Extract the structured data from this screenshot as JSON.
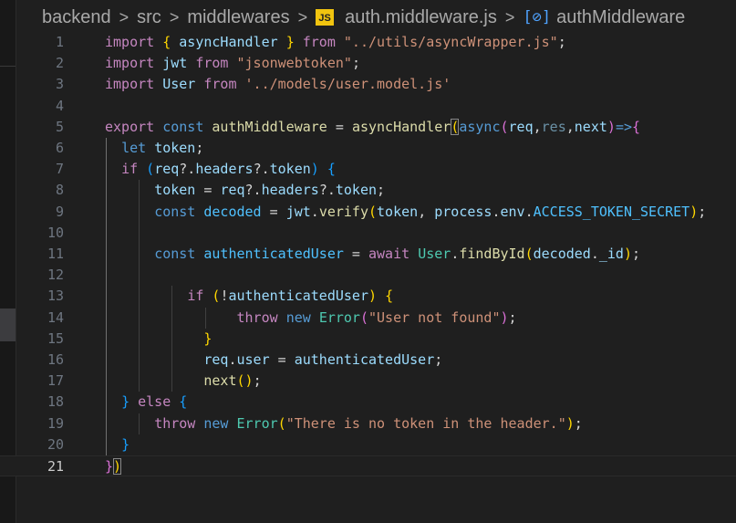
{
  "breadcrumb": {
    "items": [
      "backend",
      "src",
      "middlewares"
    ],
    "file_icon": "JS",
    "file": "auth.middleware.js",
    "symbol": "authMiddleware",
    "separator": ">"
  },
  "editor": {
    "active_line": 21,
    "lines": [
      [
        [
          "import",
          "kw"
        ],
        [
          " ",
          "p"
        ],
        [
          "{",
          "b1"
        ],
        [
          " asyncHandler ",
          "var"
        ],
        [
          "}",
          "b1"
        ],
        [
          " ",
          "p"
        ],
        [
          "from",
          "kw"
        ],
        [
          " ",
          "p"
        ],
        [
          "\"../utils/asyncWrapper.js\"",
          "str"
        ],
        [
          ";",
          "p"
        ]
      ],
      [
        [
          "import",
          "kw"
        ],
        [
          " ",
          "p"
        ],
        [
          "jwt",
          "var"
        ],
        [
          " ",
          "p"
        ],
        [
          "from",
          "kw"
        ],
        [
          " ",
          "p"
        ],
        [
          "\"jsonwebtoken\"",
          "str"
        ],
        [
          ";",
          "p"
        ]
      ],
      [
        [
          "import",
          "kw"
        ],
        [
          " ",
          "p"
        ],
        [
          "User",
          "var"
        ],
        [
          " ",
          "p"
        ],
        [
          "from",
          "kw"
        ],
        [
          " ",
          "p"
        ],
        [
          "'../models/user.model.js'",
          "str"
        ]
      ],
      [],
      [
        [
          "export",
          "kw"
        ],
        [
          " ",
          "p"
        ],
        [
          "const",
          "st"
        ],
        [
          " ",
          "p"
        ],
        [
          "authMiddleware",
          "fn"
        ],
        [
          " = ",
          "p"
        ],
        [
          "asyncHandler",
          "fn"
        ],
        [
          "(",
          "b1 match"
        ],
        [
          "async",
          "st"
        ],
        [
          "(",
          "b2"
        ],
        [
          "req",
          "var"
        ],
        [
          ",",
          "p"
        ],
        [
          "res",
          "dim"
        ],
        [
          ",",
          "p"
        ],
        [
          "next",
          "var"
        ],
        [
          ")",
          "b2"
        ],
        [
          "=>",
          "st"
        ],
        [
          "{",
          "b2"
        ]
      ],
      [
        [
          "  ",
          "p"
        ],
        [
          "let",
          "st"
        ],
        [
          " ",
          "p"
        ],
        [
          "token",
          "var"
        ],
        [
          ";",
          "p"
        ]
      ],
      [
        [
          "  ",
          "p"
        ],
        [
          "if",
          "kw"
        ],
        [
          " ",
          "p"
        ],
        [
          "(",
          "b3"
        ],
        [
          "req",
          "var"
        ],
        [
          "?.",
          "p"
        ],
        [
          "headers",
          "var"
        ],
        [
          "?.",
          "p"
        ],
        [
          "token",
          "var"
        ],
        [
          ")",
          "b3"
        ],
        [
          " ",
          "p"
        ],
        [
          "{",
          "b3"
        ]
      ],
      [
        [
          "      ",
          "p"
        ],
        [
          "token",
          "var"
        ],
        [
          " = ",
          "p"
        ],
        [
          "req",
          "var"
        ],
        [
          "?.",
          "p"
        ],
        [
          "headers",
          "var"
        ],
        [
          "?.",
          "p"
        ],
        [
          "token",
          "var"
        ],
        [
          ";",
          "p"
        ]
      ],
      [
        [
          "      ",
          "p"
        ],
        [
          "const",
          "st"
        ],
        [
          " ",
          "p"
        ],
        [
          "decoded",
          "cst"
        ],
        [
          " = ",
          "p"
        ],
        [
          "jwt",
          "var"
        ],
        [
          ".",
          "p"
        ],
        [
          "verify",
          "fn"
        ],
        [
          "(",
          "b1"
        ],
        [
          "token",
          "var"
        ],
        [
          ", ",
          "p"
        ],
        [
          "process",
          "var"
        ],
        [
          ".",
          "p"
        ],
        [
          "env",
          "var"
        ],
        [
          ".",
          "p"
        ],
        [
          "ACCESS_TOKEN_SECRET",
          "cst"
        ],
        [
          ")",
          "b1"
        ],
        [
          ";",
          "p"
        ]
      ],
      [],
      [
        [
          "      ",
          "p"
        ],
        [
          "const",
          "st"
        ],
        [
          " ",
          "p"
        ],
        [
          "authenticatedUser",
          "cst"
        ],
        [
          " = ",
          "p"
        ],
        [
          "await",
          "kw"
        ],
        [
          " ",
          "p"
        ],
        [
          "User",
          "cls"
        ],
        [
          ".",
          "p"
        ],
        [
          "findById",
          "fn"
        ],
        [
          "(",
          "b1"
        ],
        [
          "decoded",
          "var"
        ],
        [
          ".",
          "p"
        ],
        [
          "_id",
          "var"
        ],
        [
          ")",
          "b1"
        ],
        [
          ";",
          "p"
        ]
      ],
      [],
      [
        [
          "          ",
          "p"
        ],
        [
          "if",
          "kw"
        ],
        [
          " ",
          "p"
        ],
        [
          "(",
          "b1"
        ],
        [
          "!",
          "p"
        ],
        [
          "authenticatedUser",
          "var"
        ],
        [
          ")",
          "b1"
        ],
        [
          " ",
          "p"
        ],
        [
          "{",
          "b1"
        ]
      ],
      [
        [
          "                ",
          "p"
        ],
        [
          "throw",
          "kw"
        ],
        [
          " ",
          "p"
        ],
        [
          "new",
          "st"
        ],
        [
          " ",
          "p"
        ],
        [
          "Error",
          "cls"
        ],
        [
          "(",
          "b2"
        ],
        [
          "\"User not found\"",
          "str"
        ],
        [
          ")",
          "b2"
        ],
        [
          ";",
          "p"
        ]
      ],
      [
        [
          "            ",
          "p"
        ],
        [
          "}",
          "b1"
        ]
      ],
      [
        [
          "            ",
          "p"
        ],
        [
          "req",
          "var"
        ],
        [
          ".",
          "p"
        ],
        [
          "user",
          "var"
        ],
        [
          " = ",
          "p"
        ],
        [
          "authenticatedUser",
          "var"
        ],
        [
          ";",
          "p"
        ]
      ],
      [
        [
          "            ",
          "p"
        ],
        [
          "next",
          "fn"
        ],
        [
          "(",
          "b1"
        ],
        [
          ")",
          "b1"
        ],
        [
          ";",
          "p"
        ]
      ],
      [
        [
          "  ",
          "p"
        ],
        [
          "}",
          "b3"
        ],
        [
          " ",
          "p"
        ],
        [
          "else",
          "kw"
        ],
        [
          " ",
          "p"
        ],
        [
          "{",
          "b3"
        ]
      ],
      [
        [
          "      ",
          "p"
        ],
        [
          "throw",
          "kw"
        ],
        [
          " ",
          "p"
        ],
        [
          "new",
          "st"
        ],
        [
          " ",
          "p"
        ],
        [
          "Error",
          "cls"
        ],
        [
          "(",
          "b1"
        ],
        [
          "\"There is no token in the header.\"",
          "str"
        ],
        [
          ")",
          "b1"
        ],
        [
          ";",
          "p"
        ]
      ],
      [
        [
          "  ",
          "p"
        ],
        [
          "}",
          "b3"
        ]
      ],
      [
        [
          "}",
          "b2"
        ],
        [
          ")",
          "b1 match"
        ]
      ]
    ]
  }
}
